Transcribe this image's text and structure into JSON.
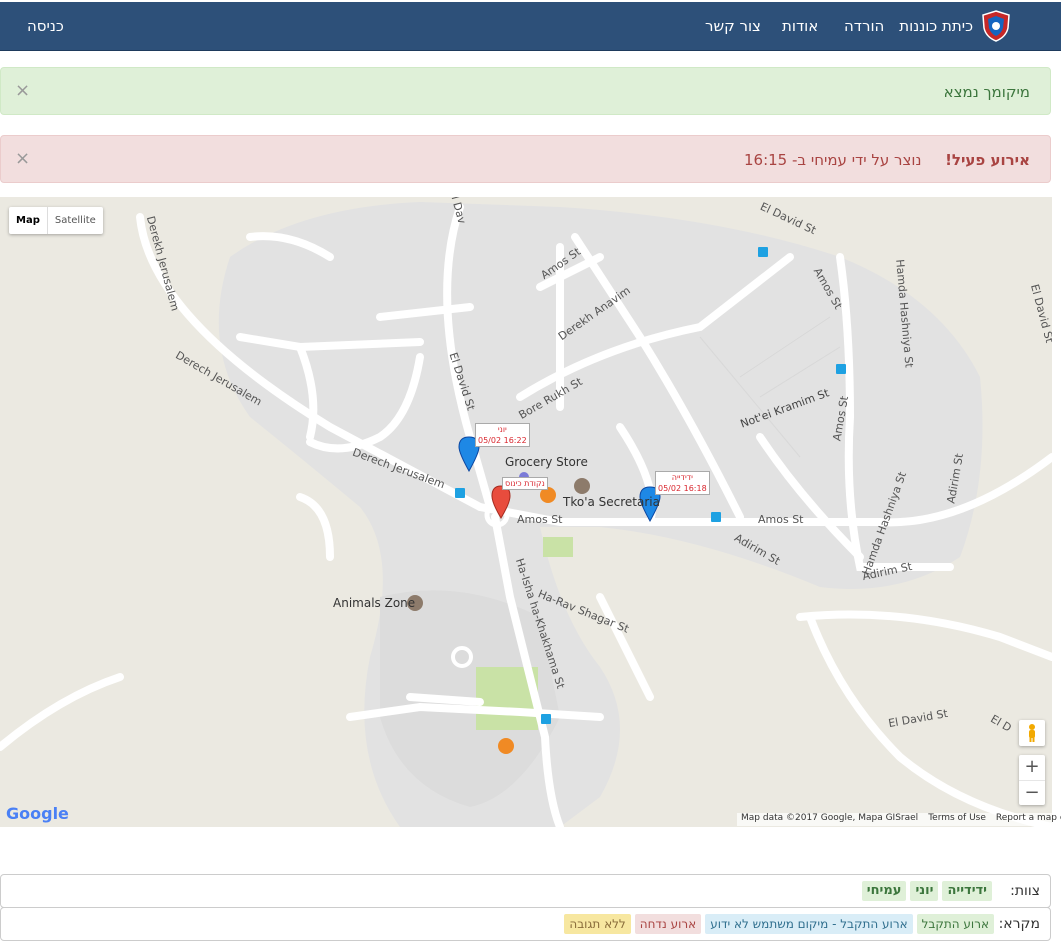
{
  "navbar": {
    "brand": "כיתת כוננות",
    "links": [
      "הורדה",
      "אודות",
      "צור קשר"
    ],
    "login": "כניסה"
  },
  "alerts": {
    "success": "מיקומך נמצא",
    "danger_strong": "אירוע פעיל!",
    "danger_text": "נוצר על ידי עמיחי ב- 16:15",
    "close": "×"
  },
  "map": {
    "type_map": "Map",
    "type_satellite": "Satellite",
    "zoom_in": "+",
    "zoom_out": "−",
    "google": "Google",
    "attribution": [
      "Map data ©2017 Google, Mapa GISrael",
      "Terms of Use",
      "Report a map error"
    ],
    "streets": {
      "derech_jerusalem_1": "Derech Jerusalem",
      "derech_jerusalem_2": "Derech Jerusalem",
      "derekh_jerusalem": "Derekh Jerusalem",
      "el_david_1": "El David St",
      "el_david_2": "El David St",
      "el_david_3": "El David St",
      "el_david_4": "El David St",
      "el_david_5": "El Dav",
      "amos_1": "Amos St",
      "amos_2": "Amos St",
      "amos_3": "Amos St",
      "amos_4": "Amos St",
      "amos_5": "Amos St",
      "derekh_anavim": "Derekh Anavim",
      "bore_ruakh": "Bore Rukh St",
      "noteikramim": "Not'ei Kramim St",
      "hamda_hashniya_1": "Hamda Hashniya St",
      "hamda_hashniya_2": "Hamda Hashniya St",
      "adirim_1": "Adirim St",
      "adirim_2": "Adirim St",
      "adirim_3": "Adirim St",
      "haisha": "Ha-Isha ha-Khakhama St",
      "harav_shagar": "Ha-Rav Shagar St",
      "el_d": "El D"
    },
    "pois": {
      "grocery": "Grocery Store",
      "tkoa": "Tko'a Secretaria",
      "animals": "Animals Zone"
    },
    "markers": [
      {
        "name": "יוני",
        "time": "05/02 16:22"
      },
      {
        "name": "ידידייה",
        "time": "05/02 16:18"
      },
      {
        "name": "נקודת כינוס"
      }
    ]
  },
  "team": {
    "label": "צוות:",
    "members": [
      "ידידייה",
      "יוני",
      "עמיחי"
    ]
  },
  "legend": {
    "label": "מקרא:",
    "items": [
      "ארוע התקבל",
      "ארוע התקבל - מיקום משתמש לא ידוע",
      "ארוע נדחה",
      "ללא תגובה"
    ]
  },
  "colors": {
    "navbar": "#2d5079",
    "success_bg": "#dff0d8",
    "danger_bg": "#f2dede",
    "map_bg": "#ebe9e1"
  }
}
